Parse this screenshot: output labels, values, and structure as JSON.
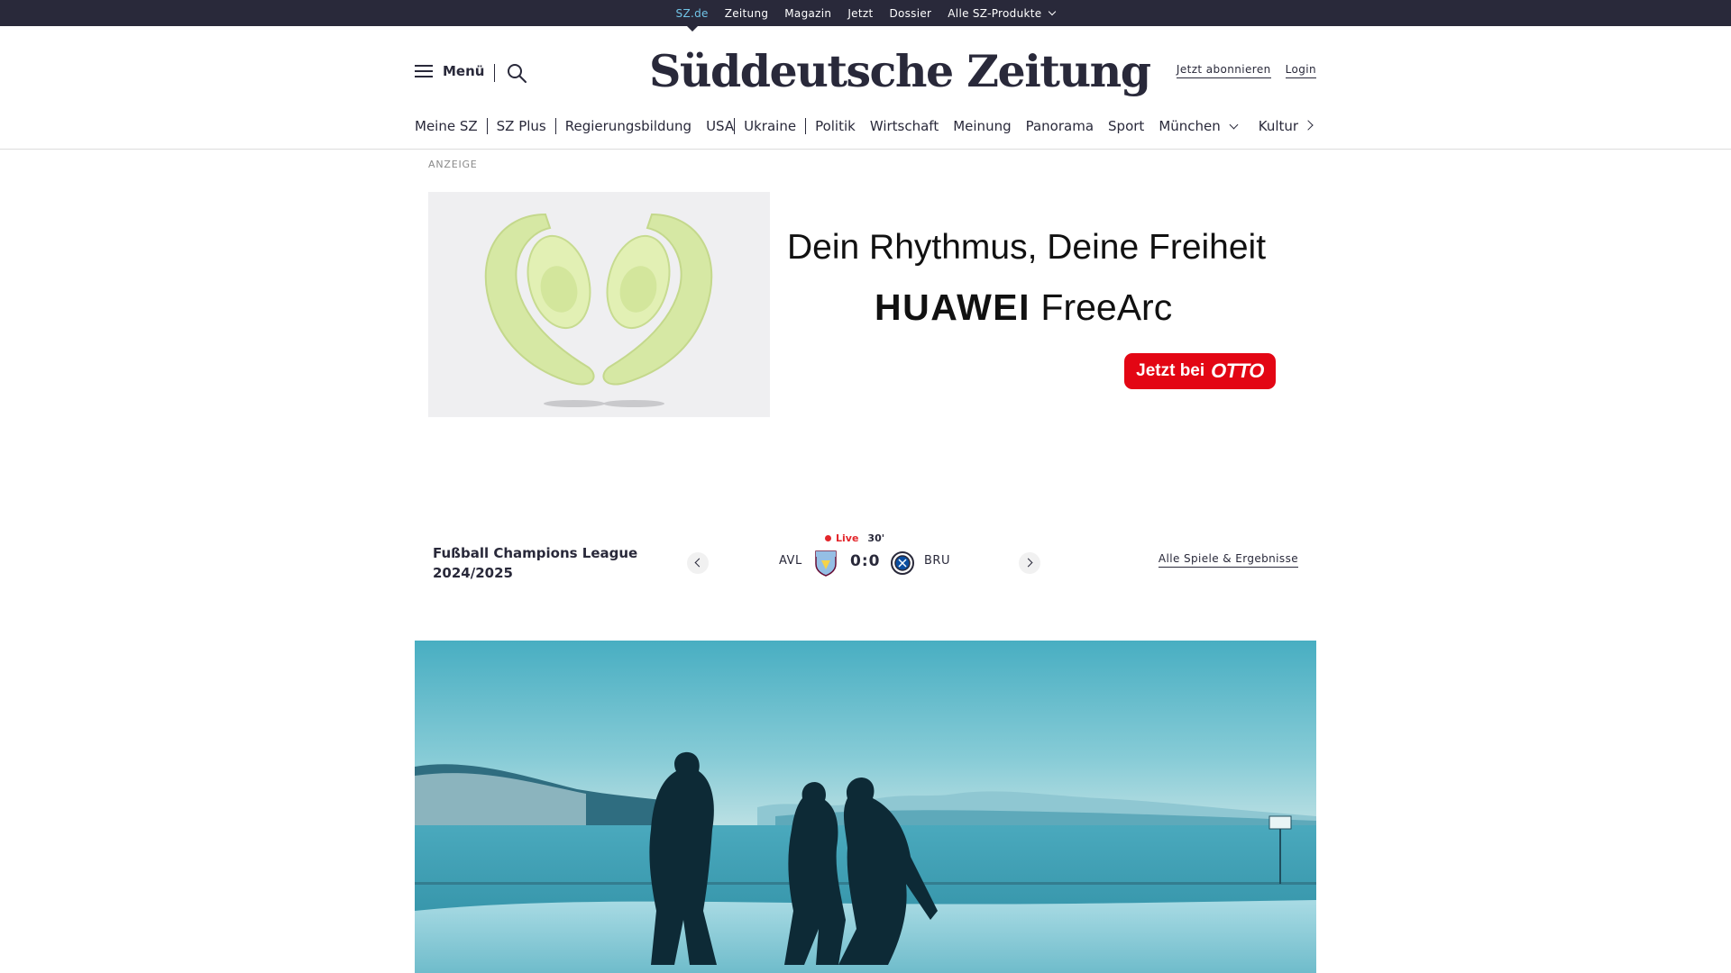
{
  "topbar": {
    "links": [
      "SZ.de",
      "Zeitung",
      "Magazin",
      "Jetzt",
      "Dossier",
      "Alle SZ-Produkte"
    ]
  },
  "header": {
    "menu_label": "Menü",
    "logo": "Süddeutsche Zeitung",
    "subscribe": "Jetzt abonnieren",
    "login": "Login"
  },
  "sections": [
    "Meine SZ",
    "SZ Plus",
    "Regierungsbildung",
    "USA",
    "Ukraine",
    "Politik",
    "Wirtschaft",
    "Meinung",
    "Panorama",
    "Sport",
    "München",
    "Kultur"
  ],
  "ad": {
    "label": "ANZEIGE",
    "headline": "Dein Rhythmus, Deine Freiheit",
    "brand": "HUAWEI",
    "product": "FreeArc",
    "cta": "Jetzt bei",
    "cta_brand": "OTTO"
  },
  "score": {
    "league_line1": "Fußball Champions League",
    "league_line2": "2024/2025",
    "live": "Live",
    "minute": "30'",
    "home": "AVL",
    "result": "0:0",
    "away": "BRU",
    "all_games": "Alle Spiele & Ergebnisse"
  },
  "colors": {
    "topbar_bg": "#29293a",
    "active_link": "#71c5e8",
    "live_red": "#e3262b",
    "otto_red": "#e30614",
    "hero_teal": "#4fb7c9"
  },
  "icons": [
    "hamburger-icon",
    "search-icon",
    "chevron-down-icon",
    "chevron-right-icon",
    "chevron-left-icon",
    "live-dot-icon",
    "club-crest-icon"
  ]
}
